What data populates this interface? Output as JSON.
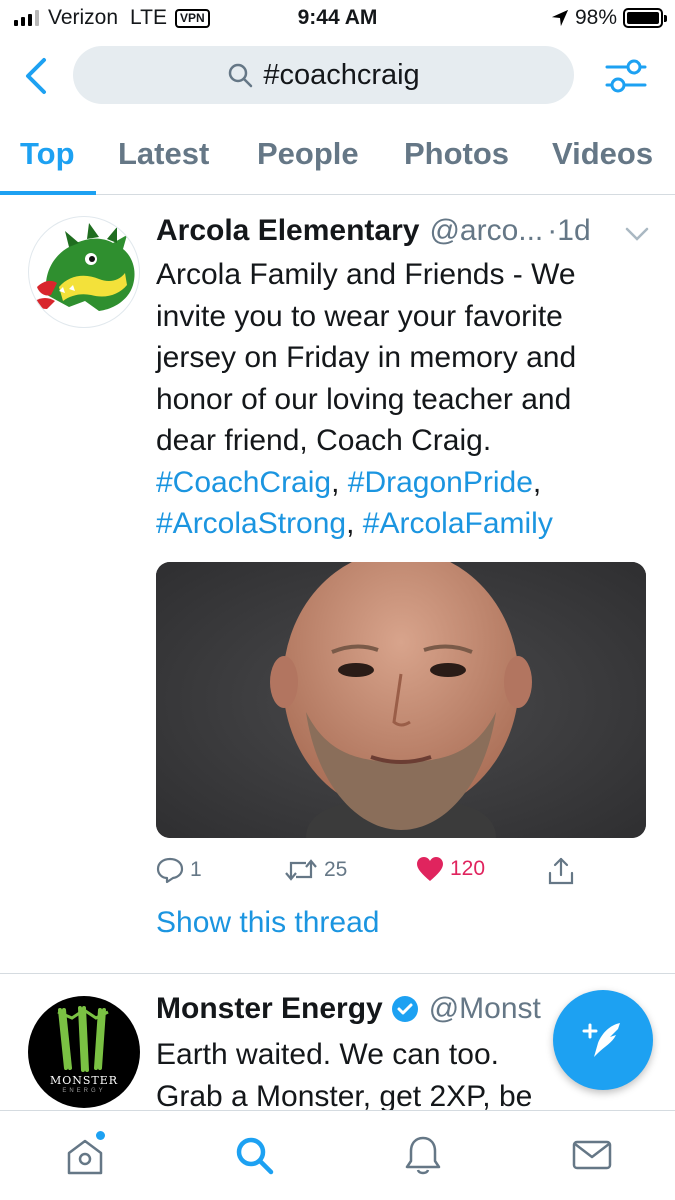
{
  "status_bar": {
    "carrier": "Verizon",
    "network": "LTE",
    "vpn": "VPN",
    "time": "9:44 AM",
    "battery": "98%",
    "battery_level": 0.98
  },
  "search": {
    "query": "#coachcraig"
  },
  "tabs": [
    {
      "label": "Top",
      "active": true
    },
    {
      "label": "Latest",
      "active": false
    },
    {
      "label": "People",
      "active": false
    },
    {
      "label": "Photos",
      "active": false
    },
    {
      "label": "Videos",
      "active": false
    }
  ],
  "tweets": [
    {
      "name": "Arcola Elementary",
      "handle": "@arco...",
      "time": "·1d",
      "text_lines": [
        "Arcola Family and Friends - We",
        "invite you to wear your favorite",
        "jersey on Friday in memory and",
        "honor of our loving teacher and",
        "dear friend, Coach Craig."
      ],
      "hashtags": [
        "#CoachCraig",
        "#DragonPride",
        "#ArcolaStrong",
        "#ArcolaFamily"
      ],
      "replies": "1",
      "retweets": "25",
      "likes": "120",
      "show_thread": "Show this thread",
      "avatar_icon": "dragon-logo-icon"
    },
    {
      "name": "Monster Energy",
      "handle": "@Monst",
      "verified": true,
      "text_lines": [
        "Earth waited. We can too.",
        "Grab a Monster, get 2XP, be"
      ],
      "avatar_brand": "MONSTER",
      "avatar_sub": "ENERGY"
    }
  ],
  "colors": {
    "accent": "#1da1f2",
    "link": "#1b95e0",
    "like": "#e0245e",
    "muted": "#657786",
    "search_bg": "#e6ecf0"
  },
  "bottom_nav": [
    "home-icon",
    "search-icon",
    "notifications-icon",
    "messages-icon"
  ]
}
